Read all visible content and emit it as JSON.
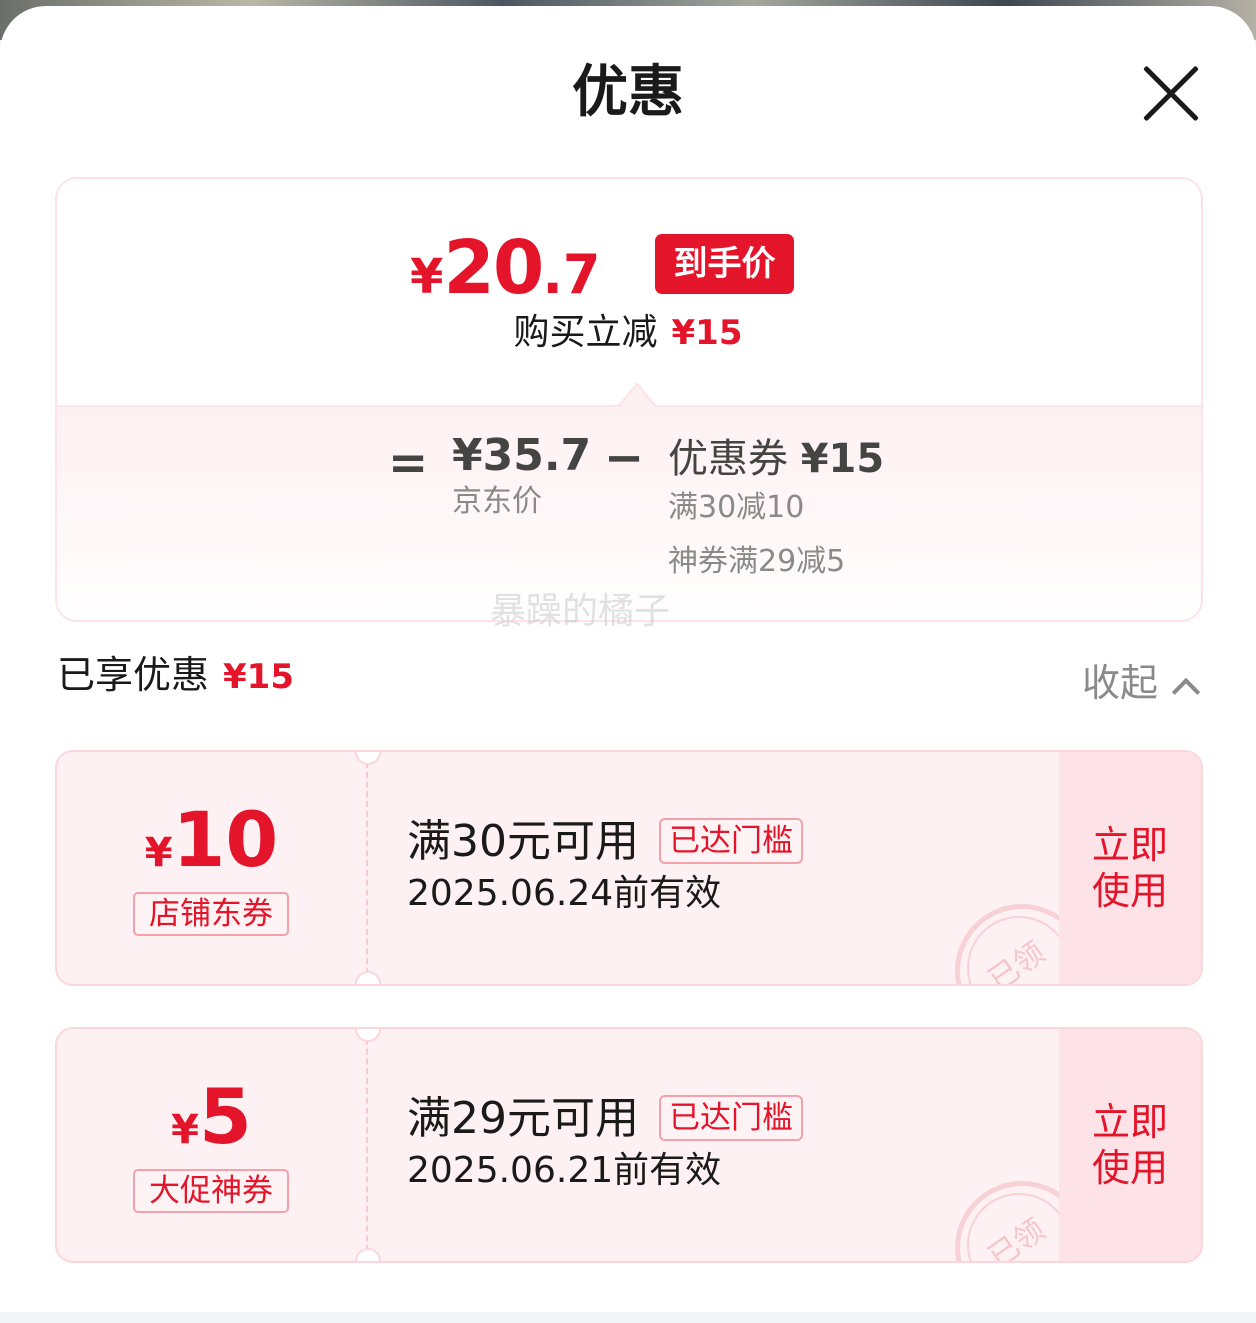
{
  "header": {
    "title": "优惠"
  },
  "price_summary": {
    "currency": "¥",
    "final_price_int": "20",
    "final_price_dec": ".7",
    "final_price_tag": "到手价",
    "instant_cut_label": "购买立减",
    "instant_cut_value": "¥15",
    "equals_sign": "=",
    "jd_price": "¥35.7",
    "jd_price_label": "京东价",
    "minus_sign": "−",
    "coupon_label": "优惠券",
    "coupon_value": "¥15",
    "coupon_details": [
      "满30减10",
      "神券满29减5"
    ]
  },
  "watermark": "暴躁的橘子",
  "enjoyed": {
    "label": "已享优惠",
    "value": "¥15",
    "collapse_label": "收起"
  },
  "coupons": [
    {
      "currency": "¥",
      "amount": "10",
      "type": "店铺东券",
      "condition": "满30元可用",
      "status": "已达门槛",
      "expiry": "2025.06.24前有效",
      "use_label": "立即使用",
      "stamp": "已领"
    },
    {
      "currency": "¥",
      "amount": "5",
      "type": "大促神券",
      "condition": "满29元可用",
      "status": "已达门槛",
      "expiry": "2025.06.21前有效",
      "use_label": "立即使用",
      "stamp": "已领"
    }
  ],
  "colors": {
    "accent": "#e4142a",
    "coupon_bg": "#fdf1f3",
    "muted": "#8a8a8a"
  }
}
